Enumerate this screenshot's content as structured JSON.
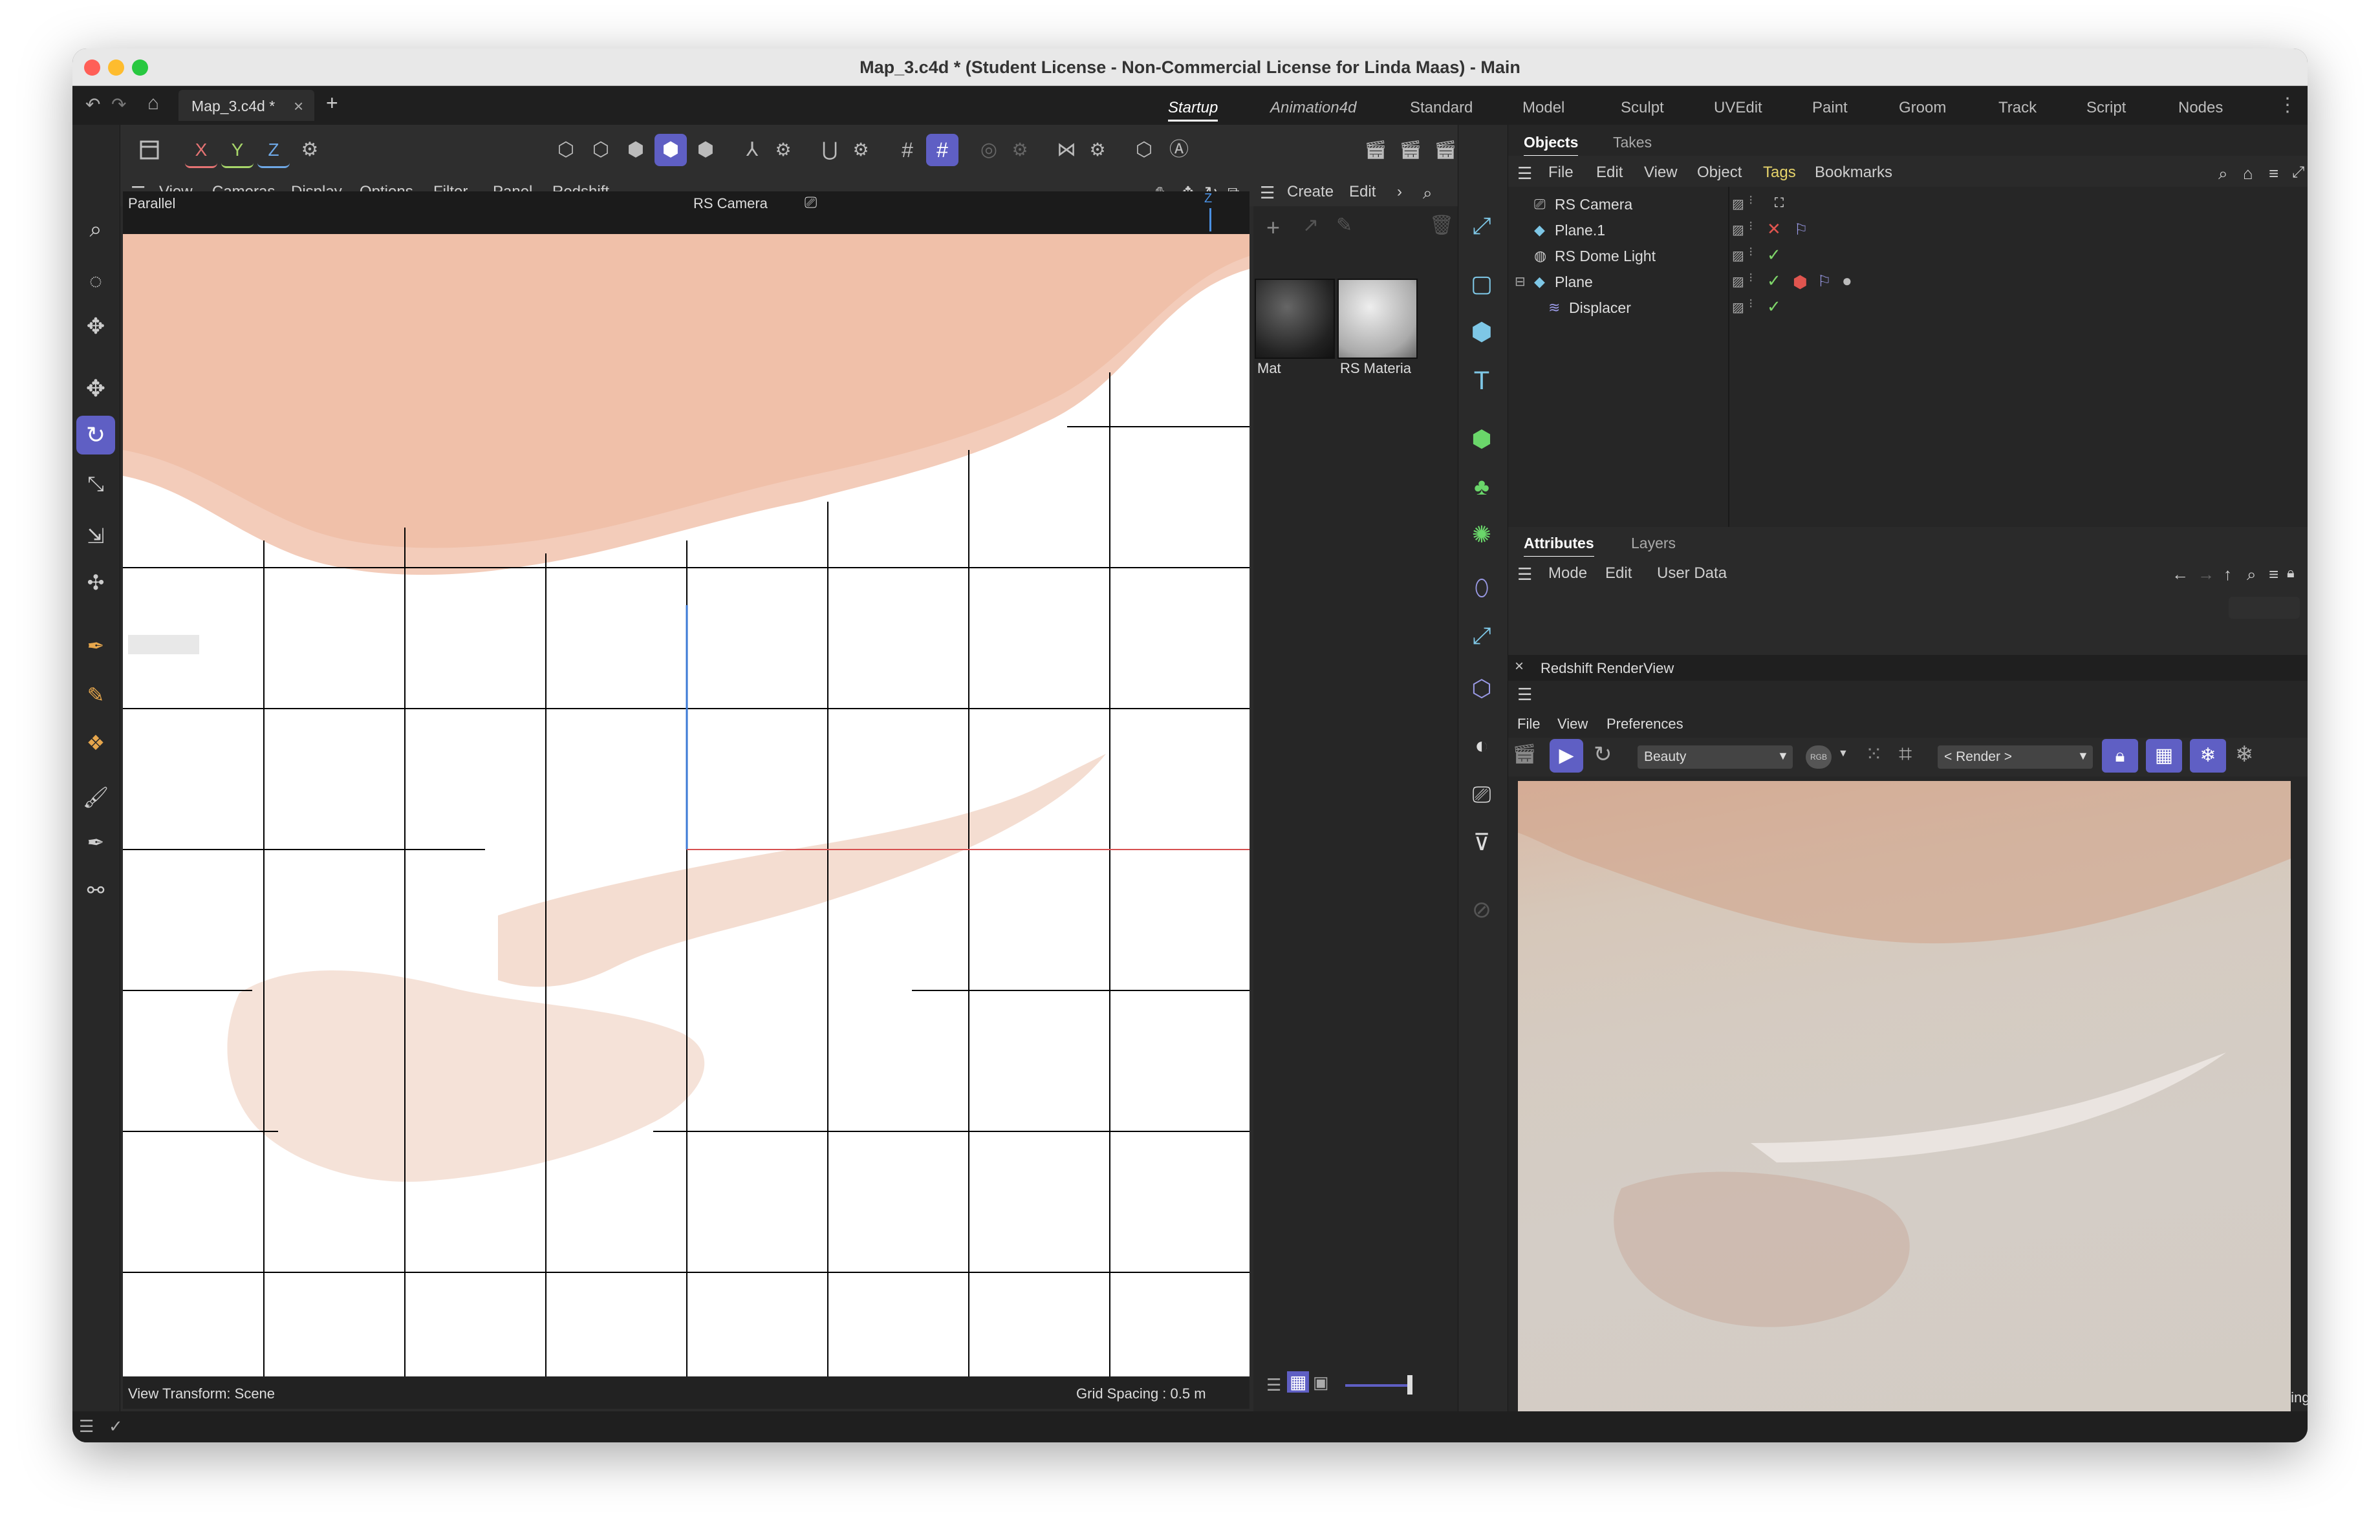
{
  "window": {
    "title": "Map_3.c4d * (Student License - Non-Commercial License for Linda Maas) - Main"
  },
  "doc_tab": {
    "label": "Map_3.c4d *",
    "close": "×",
    "add": "+"
  },
  "workspaces": [
    "Startup",
    "Animation4d",
    "Standard",
    "Model",
    "Sculpt",
    "UVEdit",
    "Paint",
    "Groom",
    "Track",
    "Script",
    "Nodes"
  ],
  "workspace_active": "Startup",
  "axis_buttons": {
    "x": "X",
    "y": "Y",
    "z": "Z"
  },
  "viewport_menu": [
    "View",
    "Cameras",
    "Display",
    "Options",
    "Filter",
    "Panel",
    "Redshift"
  ],
  "viewport": {
    "projection": "Parallel",
    "camera": "RS Camera",
    "view_transform": "View Transform: Scene",
    "grid_spacing": "Grid Spacing : 0.5 m",
    "axis_z": "Z"
  },
  "material_menu": [
    "Create",
    "Edit"
  ],
  "materials": [
    {
      "name": "Mat"
    },
    {
      "name": "RS Materia"
    }
  ],
  "object_tabs": [
    "Objects",
    "Takes"
  ],
  "object_menu": [
    "File",
    "Edit",
    "View",
    "Object",
    "Tags",
    "Bookmarks"
  ],
  "objects": [
    {
      "name": "RS Camera",
      "status": ""
    },
    {
      "name": "Plane.1",
      "status": "✕"
    },
    {
      "name": "RS Dome Light",
      "status": "✓"
    },
    {
      "name": "Plane",
      "status": "✓"
    },
    {
      "name": "Displacer",
      "status": "✓"
    }
  ],
  "attr_tabs": [
    "Attributes",
    "Layers"
  ],
  "attr_menu": [
    "Mode",
    "Edit",
    "User Data"
  ],
  "renderview": {
    "title": "Redshift RenderView",
    "close": "×",
    "menu": [
      "File",
      "View",
      "Preferences"
    ],
    "aov": "Beauty",
    "render_select": "< Render >",
    "rgb": "RGB",
    "status": "Rendering"
  },
  "colors": {
    "accent": "#5f5fc4",
    "active_ws": "#ffffff",
    "tags_yellow": "#e6d36a",
    "check_green": "#7fd66a",
    "cross_red": "#e0554f"
  }
}
